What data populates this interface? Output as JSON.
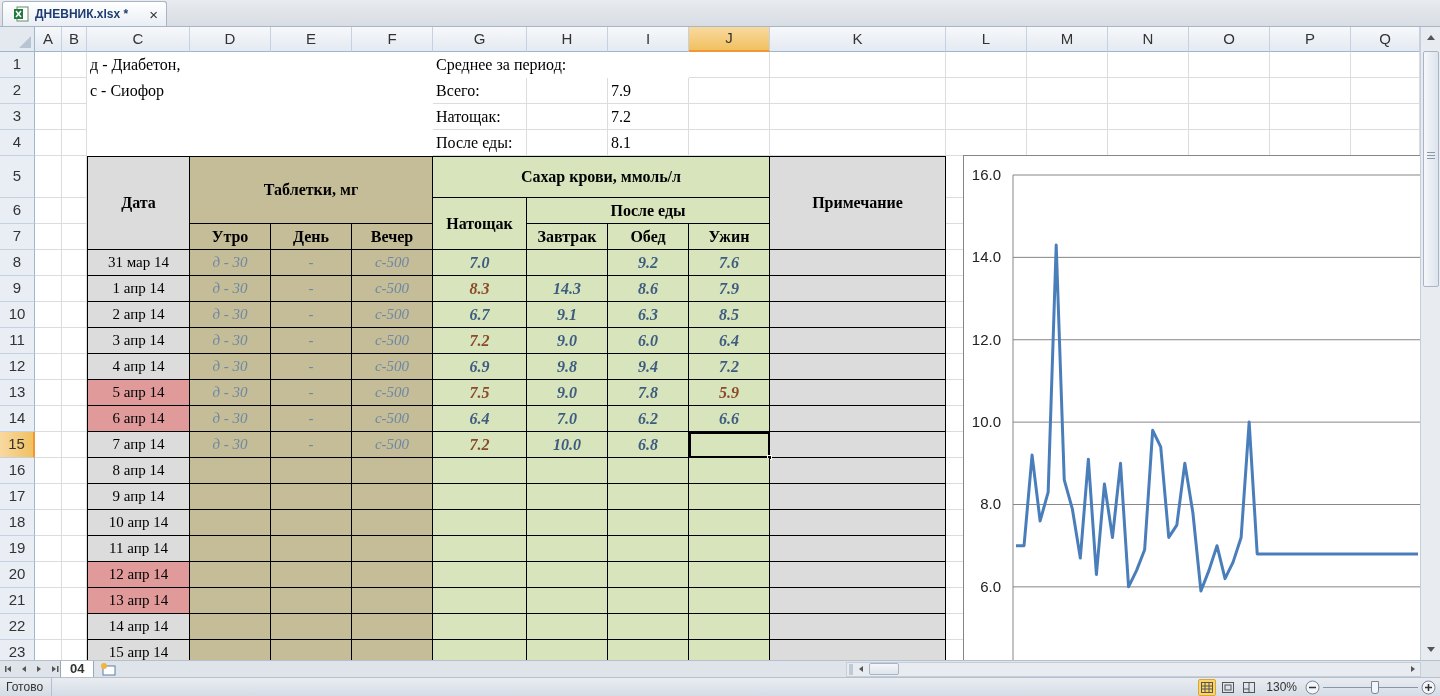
{
  "file_tab": {
    "title": "ДНЕВНИК.xlsx *",
    "close": "×"
  },
  "sheet": {
    "columns": [
      {
        "label": "A",
        "selected": false
      },
      {
        "label": "B",
        "selected": false
      },
      {
        "label": "C",
        "selected": false
      },
      {
        "label": "D",
        "selected": false
      },
      {
        "label": "E",
        "selected": false
      },
      {
        "label": "F",
        "selected": false
      },
      {
        "label": "G",
        "selected": false
      },
      {
        "label": "H",
        "selected": false
      },
      {
        "label": "I",
        "selected": false
      },
      {
        "label": "J",
        "selected": true
      },
      {
        "label": "K",
        "selected": false
      },
      {
        "label": "L",
        "selected": false
      },
      {
        "label": "M",
        "selected": false
      },
      {
        "label": "N",
        "selected": false
      },
      {
        "label": "O",
        "selected": false
      },
      {
        "label": "P",
        "selected": false
      },
      {
        "label": "Q",
        "selected": false
      }
    ],
    "row_headers": [
      {
        "label": "1",
        "selected": false
      },
      {
        "label": "2",
        "selected": false
      },
      {
        "label": "3",
        "selected": false
      },
      {
        "label": "4",
        "selected": false
      },
      {
        "label": "5",
        "selected": false
      },
      {
        "label": "6",
        "selected": false
      },
      {
        "label": "7",
        "selected": false
      },
      {
        "label": "8",
        "selected": false
      },
      {
        "label": "9",
        "selected": false
      },
      {
        "label": "10",
        "selected": false
      },
      {
        "label": "11",
        "selected": false
      },
      {
        "label": "12",
        "selected": false
      },
      {
        "label": "13",
        "selected": false
      },
      {
        "label": "14",
        "selected": false
      },
      {
        "label": "15",
        "selected": true
      },
      {
        "label": "16",
        "selected": false
      },
      {
        "label": "17",
        "selected": false
      },
      {
        "label": "18",
        "selected": false
      },
      {
        "label": "19",
        "selected": false
      },
      {
        "label": "20",
        "selected": false
      },
      {
        "label": "21",
        "selected": false
      },
      {
        "label": "22",
        "selected": false
      },
      {
        "label": "23",
        "selected": false
      }
    ],
    "legend": [
      "д - Диабетон,",
      "с - Сиофор"
    ],
    "summary": {
      "title": "Среднее за период:",
      "items": [
        {
          "label": "Всего:",
          "value": "7.9"
        },
        {
          "label": "Натощак:",
          "value": "7.2"
        },
        {
          "label": "После еды:",
          "value": "8.1"
        }
      ]
    },
    "table": {
      "date_header": "Дата",
      "pills_header": "Таблетки, мг",
      "pill_times": [
        "Утро",
        "День",
        "Вечер"
      ],
      "sugar_header": "Сахар крови, ммоль/л",
      "fasting_header": "Натощак",
      "after_meal_header": "После еды",
      "meals": [
        "Завтрак",
        "Обед",
        "Ужин"
      ],
      "note_header": "Примечание",
      "rows": [
        {
          "date": "31 мар 14",
          "weekend": false,
          "meds": [
            "д - 30",
            "-",
            "с-500"
          ],
          "fasting": {
            "value": "7.0",
            "flagged": false
          },
          "lunch": {
            "value": "9.2",
            "flagged": false
          },
          "dinner": {
            "value": "7.6",
            "flagged": false
          }
        },
        {
          "date": "1 апр 14",
          "weekend": false,
          "meds": [
            "д - 30",
            "-",
            "с-500"
          ],
          "fasting": {
            "value": "8.3",
            "flagged": true
          },
          "breakfast": {
            "value": "14.3",
            "flagged": false
          },
          "lunch": {
            "value": "8.6",
            "flagged": false
          },
          "dinner": {
            "value": "7.9",
            "flagged": false
          }
        },
        {
          "date": "2 апр 14",
          "weekend": false,
          "meds": [
            "д - 30",
            "-",
            "с-500"
          ],
          "fasting": {
            "value": "6.7",
            "flagged": false
          },
          "breakfast": {
            "value": "9.1",
            "flagged": false
          },
          "lunch": {
            "value": "6.3",
            "flagged": false
          },
          "dinner": {
            "value": "8.5",
            "flagged": false
          }
        },
        {
          "date": "3 апр 14",
          "weekend": false,
          "meds": [
            "д - 30",
            "-",
            "с-500"
          ],
          "fasting": {
            "value": "7.2",
            "flagged": true
          },
          "breakfast": {
            "value": "9.0",
            "flagged": false
          },
          "lunch": {
            "value": "6.0",
            "flagged": false
          },
          "dinner": {
            "value": "6.4",
            "flagged": false
          }
        },
        {
          "date": "4 апр 14",
          "weekend": false,
          "meds": [
            "д - 30",
            "-",
            "с-500"
          ],
          "fasting": {
            "value": "6.9",
            "flagged": false
          },
          "breakfast": {
            "value": "9.8",
            "flagged": false
          },
          "lunch": {
            "value": "9.4",
            "flagged": false
          },
          "dinner": {
            "value": "7.2",
            "flagged": false
          }
        },
        {
          "date": "5 апр 14",
          "weekend": true,
          "meds": [
            "д - 30",
            "-",
            "с-500"
          ],
          "fasting": {
            "value": "7.5",
            "flagged": true
          },
          "breakfast": {
            "value": "9.0",
            "flagged": false
          },
          "lunch": {
            "value": "7.8",
            "flagged": false
          },
          "dinner": {
            "value": "5.9",
            "flagged": true
          }
        },
        {
          "date": "6 апр 14",
          "weekend": true,
          "meds": [
            "д - 30",
            "-",
            "с-500"
          ],
          "fasting": {
            "value": "6.4",
            "flagged": false
          },
          "breakfast": {
            "value": "7.0",
            "flagged": false
          },
          "lunch": {
            "value": "6.2",
            "flagged": false
          },
          "dinner": {
            "value": "6.6",
            "flagged": false
          }
        },
        {
          "date": "7 апр 14",
          "weekend": false,
          "meds": [
            "д - 30",
            "-",
            "с-500"
          ],
          "fasting": {
            "value": "7.2",
            "flagged": true
          },
          "breakfast": {
            "value": "10.0",
            "flagged": false
          },
          "lunch": {
            "value": "6.8",
            "flagged": false
          }
        },
        {
          "date": "8 апр 14",
          "weekend": false
        },
        {
          "date": "9 апр 14",
          "weekend": false
        },
        {
          "date": "10 апр 14",
          "weekend": false
        },
        {
          "date": "11 апр 14",
          "weekend": false
        },
        {
          "date": "12 апр 14",
          "weekend": true
        },
        {
          "date": "13 апр 14",
          "weekend": true
        },
        {
          "date": "14 апр 14",
          "weekend": false
        },
        {
          "date": "15 апр 14",
          "weekend": false
        }
      ]
    },
    "chart": {
      "chart_data": {
        "type": "line",
        "grid": true,
        "ylim": [
          4.2,
          16
        ],
        "yticks": [
          {
            "value": 6,
            "label": "6.0"
          },
          {
            "value": 8,
            "label": "8.0"
          },
          {
            "value": 10,
            "label": "10.0"
          },
          {
            "value": 12,
            "label": "12.0"
          },
          {
            "value": 14,
            "label": "14.0"
          },
          {
            "value": 16,
            "label": "16.0"
          }
        ],
        "series": [
          {
            "color": "#4a7ebb",
            "values": [
              7.0,
              7.0,
              9.2,
              7.6,
              8.3,
              14.3,
              8.6,
              7.9,
              6.7,
              9.1,
              6.3,
              8.5,
              7.2,
              9.0,
              6.0,
              6.4,
              6.9,
              9.8,
              9.4,
              7.2,
              7.5,
              9.0,
              7.8,
              5.9,
              6.4,
              7.0,
              6.2,
              6.6,
              7.2,
              10.0,
              6.8,
              6.8,
              6.8,
              6.8,
              6.8,
              6.8,
              6.8,
              6.8,
              6.8,
              6.8,
              6.8,
              6.8,
              6.8,
              6.8,
              6.8,
              6.8,
              6.8,
              6.8,
              6.8,
              6.8,
              6.8
            ]
          }
        ]
      }
    }
  },
  "sheet_tabs": [
    {
      "label": "04",
      "selected": true
    }
  ],
  "status_bar": {
    "text": "Готово",
    "view_buttons": [
      {
        "kind": "normal",
        "selected": true
      },
      {
        "kind": "page_layout",
        "selected": false
      },
      {
        "kind": "page_break",
        "selected": false
      }
    ],
    "zoom": {
      "label": "130%",
      "level": 0.55
    }
  }
}
